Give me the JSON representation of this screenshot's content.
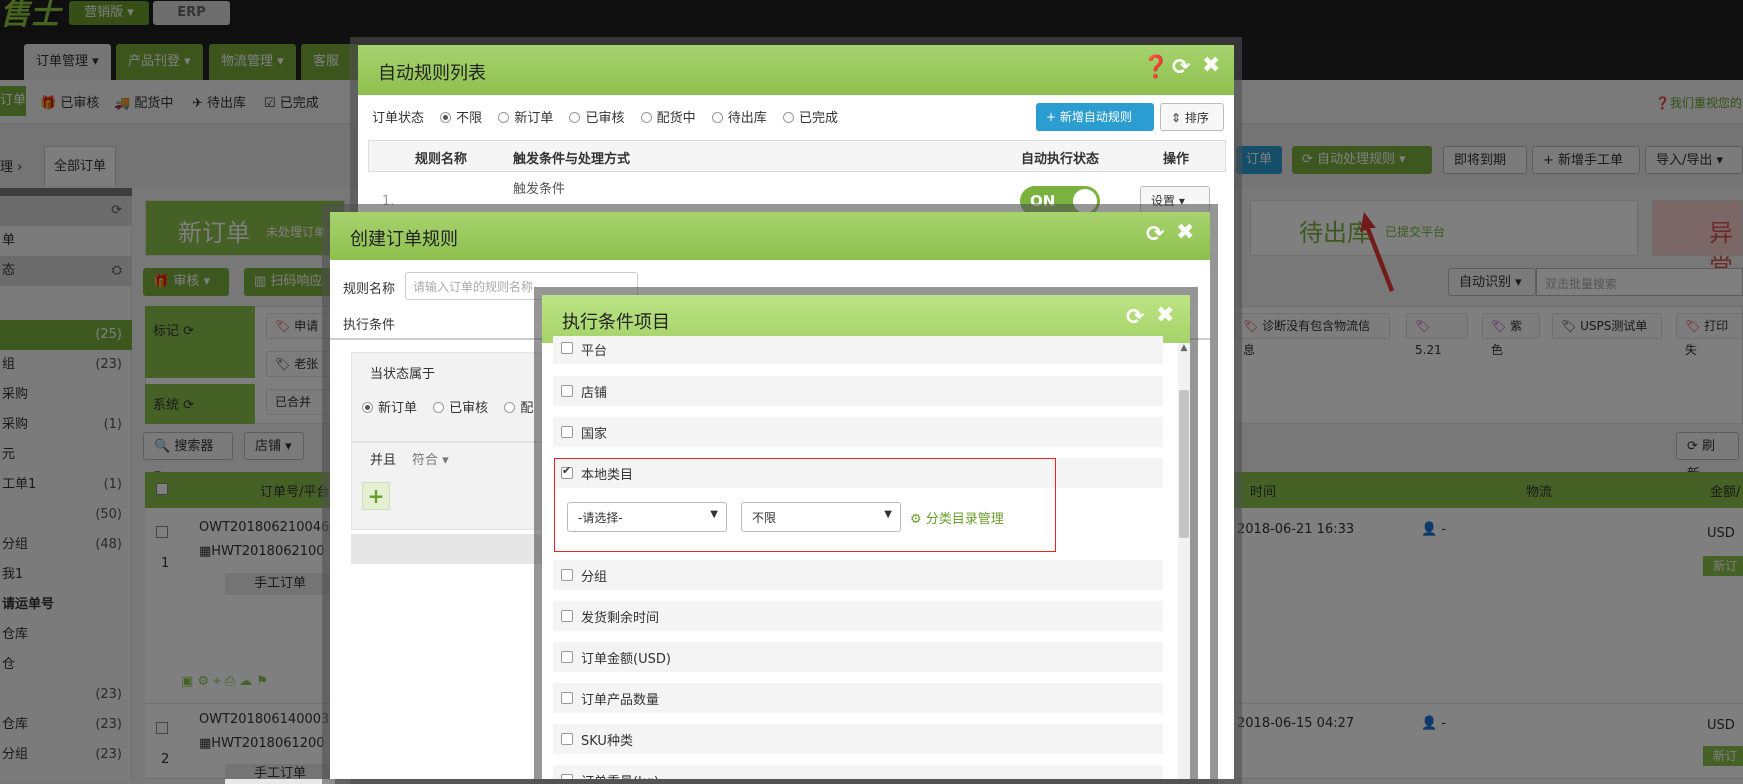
{
  "topbar": {
    "logo": "售士",
    "edition_marketing": "营销版 ▾",
    "edition_erp": "ERP"
  },
  "menu": [
    {
      "label": "订单管理 ▾"
    },
    {
      "label": "产品刊登 ▾"
    },
    {
      "label": "物流管理 ▾"
    },
    {
      "label": "客服中"
    }
  ],
  "subnav": {
    "new_label": "订单",
    "items": [
      "已审核",
      "配货中",
      "待出库",
      "已完成"
    ],
    "help": "我们重视您的"
  },
  "breadcrumb": {
    "prev": "理 ›",
    "current": "全部订单"
  },
  "sidebar": {
    "items": [
      {
        "label": "单",
        "count": ""
      },
      {
        "label": "态",
        "count": ""
      },
      {
        "label": "",
        "count": "(25)"
      },
      {
        "label": "组",
        "count": "(23)"
      },
      {
        "label": "采购",
        "count": ""
      },
      {
        "label": "采购",
        "count": "(1)"
      },
      {
        "label": "元",
        "count": ""
      },
      {
        "label": "工单1",
        "count": "(1)"
      },
      {
        "label": "",
        "count": "(50)"
      },
      {
        "label": "分组",
        "count": "(48)"
      },
      {
        "label": "我1",
        "count": ""
      },
      {
        "label": "请运单号",
        "count": ""
      },
      {
        "label": "仓库",
        "count": ""
      },
      {
        "label": "仓",
        "count": ""
      },
      {
        "label": "",
        "count": "(23)"
      },
      {
        "label": "仓库",
        "count": "(23)"
      },
      {
        "label": "分组",
        "count": "(23)"
      }
    ]
  },
  "status_cards": {
    "new_title": "新订单",
    "new_sub": "未处理订单",
    "wait_title": "待出库",
    "wait_sub": "已提交平台",
    "abnormal_title": "异常"
  },
  "toolbar": {
    "audit": "审核",
    "scan": "扫码响应",
    "add_order": "订单",
    "auto_rule": "自动处理规则",
    "due": "即将到期",
    "new_ticket": "新增手工单",
    "import_export": "导入/导出",
    "auto_identify": "自动识别",
    "batch_search_placeholder": "双击批量搜索",
    "searcher": "搜索器",
    "store": "店铺",
    "refresh": "刷新"
  },
  "tags": {
    "mark_label": "标记",
    "system_label": "系统",
    "chips": [
      "申请",
      "老张",
      "诊断没有包含物流信息",
      "5.21",
      "紫色",
      "USPS测试单",
      "打印失"
    ],
    "system_chip": "已合并"
  },
  "table": {
    "headers": [
      "订单号/平台",
      "时间",
      "物流",
      "金额/"
    ],
    "rows": [
      {
        "index": "1",
        "order_no": "OWT201806210046",
        "hwt": "HWT2018062100",
        "type": "手工订单",
        "time": "2018-06-21 16:33",
        "logistics": "-",
        "amount": "USD",
        "status": "新订"
      },
      {
        "index": "2",
        "order_no": "OWT201806140003",
        "hwt": "HWT2018061200",
        "type": "手工订单",
        "time": "2018-06-15 04:27",
        "logistics": "-",
        "amount": "USD",
        "status": "新订"
      }
    ]
  },
  "modal_rules": {
    "title": "自动规则列表",
    "status_label": "订单状态",
    "status_options": [
      "不限",
      "新订单",
      "已审核",
      "配货中",
      "待出库",
      "已完成"
    ],
    "add_button": "新增自动规则",
    "sort_button": "排序",
    "col_name": "规则名称",
    "col_trigger": "触发条件与处理方式",
    "col_state": "自动执行状态",
    "col_op": "操作",
    "row_trigger": "触发条件",
    "row_index": "1.",
    "toggle_on": "ON",
    "setting": "设置"
  },
  "modal_create": {
    "title": "创建订单规则",
    "rule_name_label": "规则名称",
    "rule_name_placeholder": "请输入订单的规则名称",
    "exec_cond": "执行条件",
    "belongs": "当状态属于",
    "state_options": [
      "新订单",
      "已审核",
      "配"
    ],
    "and_label": "并且",
    "match_label": "符合 ▾",
    "plus": "+"
  },
  "modal_exec": {
    "title": "执行条件项目",
    "options": [
      {
        "label": "平台",
        "checked": false
      },
      {
        "label": "店铺",
        "checked": false
      },
      {
        "label": "国家",
        "checked": false
      },
      {
        "label": "本地类目",
        "checked": true
      },
      {
        "label": "分组",
        "checked": false
      },
      {
        "label": "发货剩余时间",
        "checked": false
      },
      {
        "label": "订单金额(USD)",
        "checked": false
      },
      {
        "label": "订单产品数量",
        "checked": false
      },
      {
        "label": "SKU种类",
        "checked": false
      },
      {
        "label": "订单重量(kg)",
        "checked": false
      }
    ],
    "select_first": "-请选择-",
    "select_second": "不限",
    "cat_link": "分类目录管理"
  }
}
